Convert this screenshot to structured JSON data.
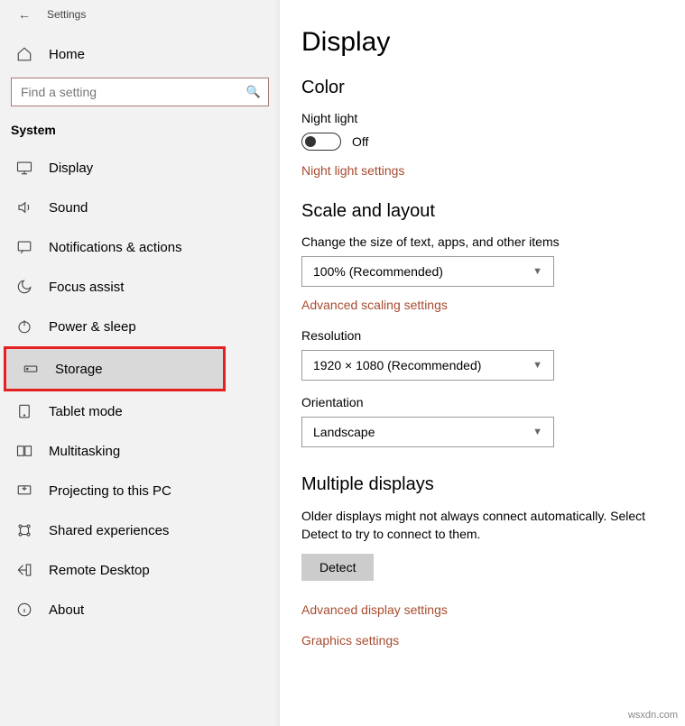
{
  "header": {
    "back_tooltip": "Back",
    "title": "Settings"
  },
  "home_label": "Home",
  "search": {
    "placeholder": "Find a setting"
  },
  "section_title": "System",
  "nav": [
    {
      "label": "Display",
      "icon": "display-icon"
    },
    {
      "label": "Sound",
      "icon": "sound-icon"
    },
    {
      "label": "Notifications & actions",
      "icon": "notifications-icon"
    },
    {
      "label": "Focus assist",
      "icon": "moon-icon"
    },
    {
      "label": "Power & sleep",
      "icon": "power-icon"
    },
    {
      "label": "Storage",
      "icon": "storage-icon",
      "highlighted": true,
      "selected": true
    },
    {
      "label": "Tablet mode",
      "icon": "tablet-icon"
    },
    {
      "label": "Multitasking",
      "icon": "multitasking-icon"
    },
    {
      "label": "Projecting to this PC",
      "icon": "projecting-icon"
    },
    {
      "label": "Shared experiences",
      "icon": "shared-icon"
    },
    {
      "label": "Remote Desktop",
      "icon": "remote-icon"
    },
    {
      "label": "About",
      "icon": "info-icon"
    }
  ],
  "main": {
    "title": "Display",
    "color": {
      "heading": "Color",
      "night_light_label": "Night light",
      "night_light_state": "Off",
      "night_light_link": "Night light settings"
    },
    "scale": {
      "heading": "Scale and layout",
      "text_size_label": "Change the size of text, apps, and other items",
      "text_size_value": "100% (Recommended)",
      "adv_scaling_link": "Advanced scaling settings",
      "resolution_label": "Resolution",
      "resolution_value": "1920 × 1080 (Recommended)",
      "orientation_label": "Orientation",
      "orientation_value": "Landscape"
    },
    "multiple": {
      "heading": "Multiple displays",
      "desc": "Older displays might not always connect automatically. Select Detect to try to connect to them.",
      "detect_button": "Detect",
      "adv_display_link": "Advanced display settings",
      "graphics_link": "Graphics settings"
    }
  },
  "watermark": "wsxdn.com"
}
